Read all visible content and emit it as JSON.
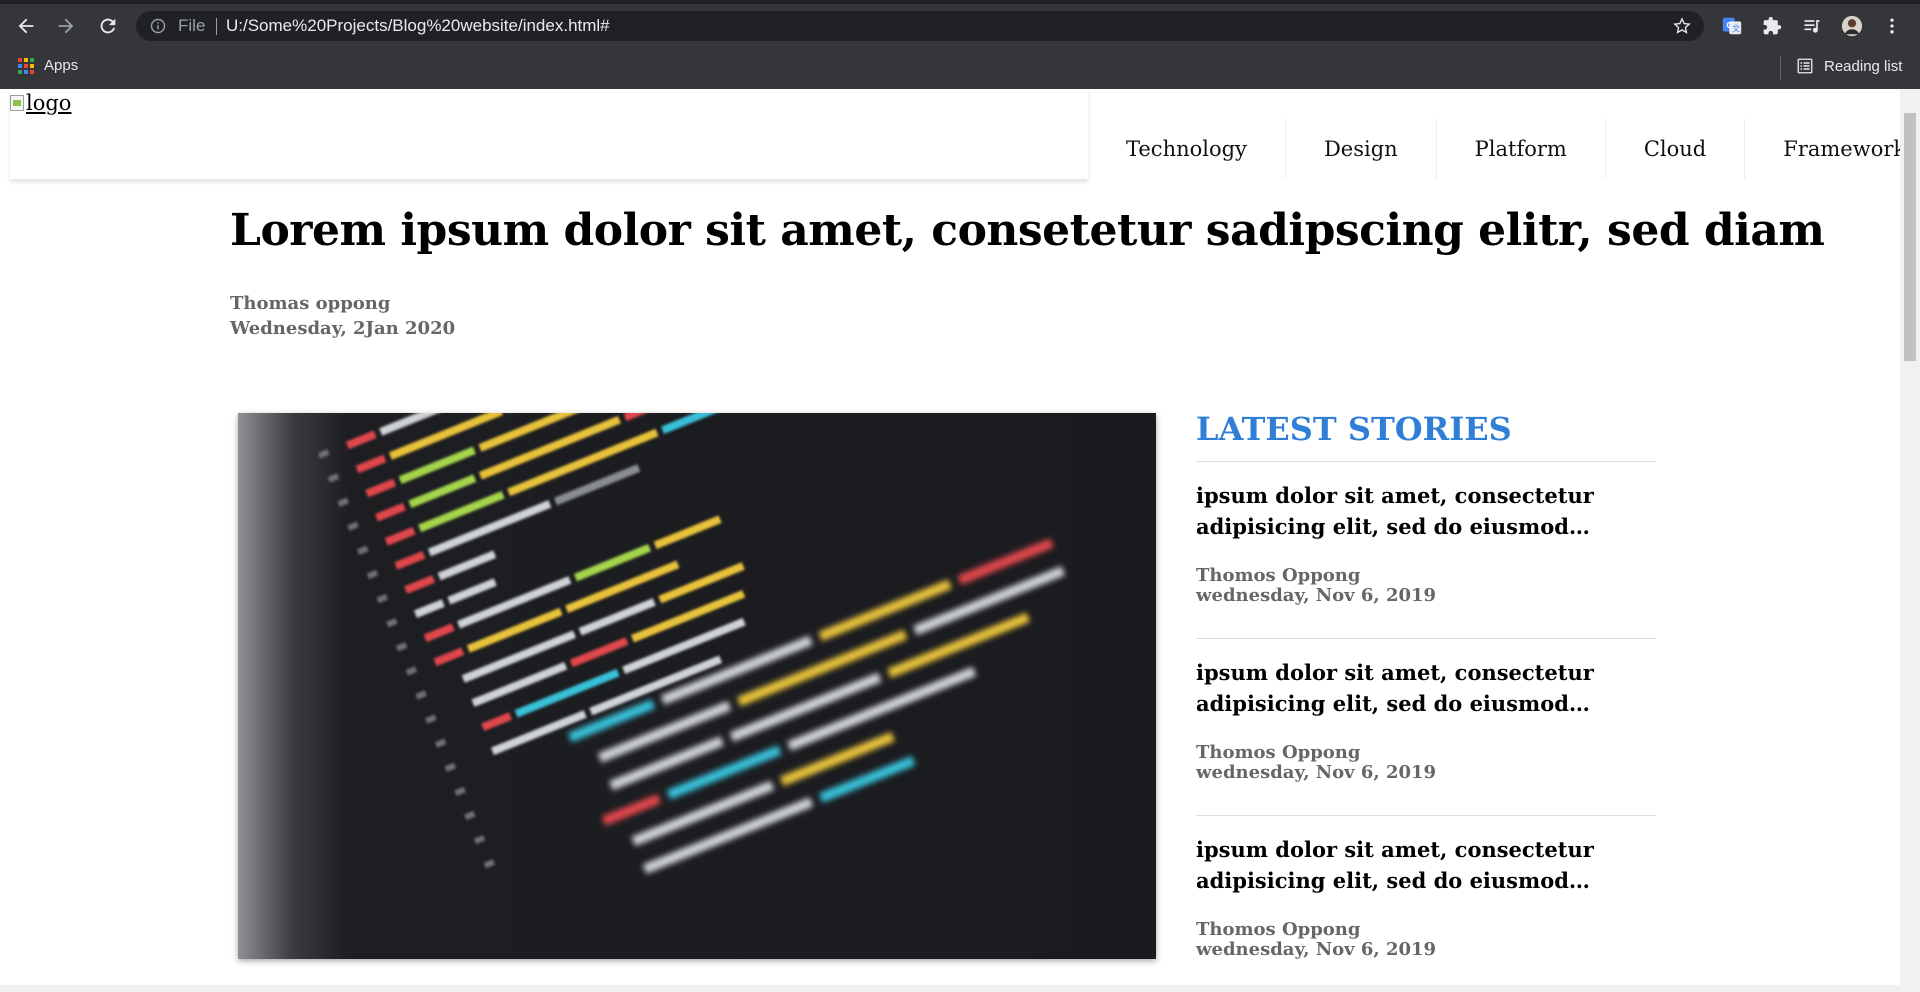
{
  "browser": {
    "address": {
      "scheme_label": "File",
      "url": "U:/Some%20Projects/Blog%20website/index.html#"
    },
    "bookmarks": {
      "apps_label": "Apps",
      "reading_list_label": "Reading list"
    },
    "colors": {
      "chrome_bg": "#35363a",
      "omnibox_bg": "#202124",
      "text": "#e8eaed"
    }
  },
  "page": {
    "logo_alt": "logo",
    "nav": [
      "Technology",
      "Design",
      "Platform",
      "Cloud",
      "Framework"
    ],
    "article": {
      "title": "Lorem ipsum dolor sit amet, consetetur sadipscing elitr, sed diam",
      "author": "Thomas oppong",
      "date": "Wednesday, 2Jan 2020"
    },
    "sidebar": {
      "title": "LATEST STORIES",
      "accent_color": "#2f7fd6",
      "stories": [
        {
          "title": "ipsum dolor sit amet, consectetur adipisicing elit, sed do eiusmod tempor incididunt",
          "author": "Thomos Oppong",
          "date": "wednesday, Nov 6, 2019"
        },
        {
          "title": "ipsum dolor sit amet, consectetur adipisicing elit, sed do eiusmod tempor incididunt",
          "author": "Thomos Oppong",
          "date": "wednesday, Nov 6, 2019"
        },
        {
          "title": "ipsum dolor sit amet, consectetur adipisicing elit, sed do eiusmod tempor incididunt",
          "author": "Thomos Oppong",
          "date": "wednesday, Nov 6, 2019"
        }
      ]
    }
  }
}
